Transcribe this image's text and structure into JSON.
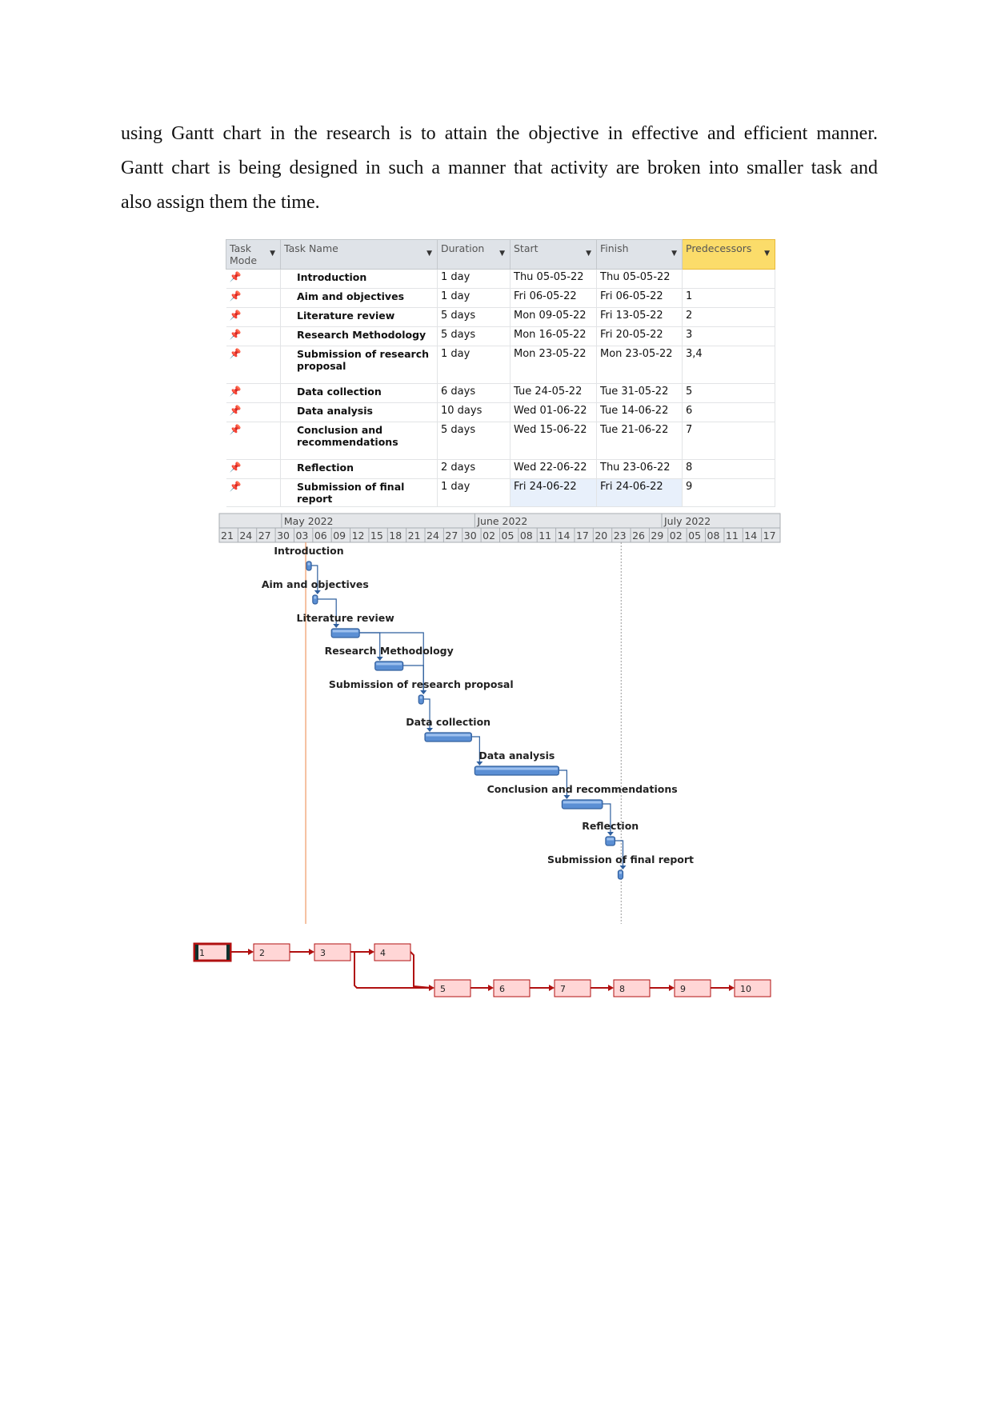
{
  "paragraph": {
    "lines": [
      "using Gantt chart in the research is to attain the objective in effective and efficient manner.",
      "Gantt chart is being designed in such a manner that activity are broken into smaller task and",
      "also assign them the time."
    ]
  },
  "table": {
    "headers": [
      "Task Mode",
      "Task Name",
      "Duration",
      "Start",
      "Finish",
      "Predecessors"
    ],
    "mode_icon": "pushpin-icon",
    "rows": [
      {
        "id": 1,
        "name": "Introduction",
        "duration": "1 day",
        "start": "Thu 05-05-22",
        "finish": "Thu 05-05-22",
        "pred": ""
      },
      {
        "id": 2,
        "name": "Aim and objectives",
        "duration": "1 day",
        "start": "Fri 06-05-22",
        "finish": "Fri 06-05-22",
        "pred": "1"
      },
      {
        "id": 3,
        "name": "Literature review",
        "duration": "5 days",
        "start": "Mon 09-05-22",
        "finish": "Fri 13-05-22",
        "pred": "2"
      },
      {
        "id": 4,
        "name": "Research Methodology",
        "duration": "5 days",
        "start": "Mon 16-05-22",
        "finish": "Fri 20-05-22",
        "pred": "3"
      },
      {
        "id": 5,
        "name": "Submission of research proposal",
        "duration": "1 day",
        "start": "Mon 23-05-22",
        "finish": "Mon 23-05-22",
        "pred": "3,4"
      },
      {
        "id": 6,
        "name": "Data collection",
        "duration": "6 days",
        "start": "Tue 24-05-22",
        "finish": "Tue 31-05-22",
        "pred": "5"
      },
      {
        "id": 7,
        "name": "Data analysis",
        "duration": "10 days",
        "start": "Wed 01-06-22",
        "finish": "Tue 14-06-22",
        "pred": "6"
      },
      {
        "id": 8,
        "name": "Conclusion and recommendations",
        "duration": "5 days",
        "start": "Wed 15-06-22",
        "finish": "Tue 21-06-22",
        "pred": "7"
      },
      {
        "id": 9,
        "name": "Reflection",
        "duration": "2 days",
        "start": "Wed 22-06-22",
        "finish": "Thu 23-06-22",
        "pred": "8"
      },
      {
        "id": 10,
        "name": "Submission of final report",
        "duration": "1 day",
        "start": "Fri 24-06-22",
        "finish": "Fri 24-06-22",
        "pred": "9"
      }
    ]
  },
  "gantt": {
    "months": [
      "May 2022",
      "June 2022",
      "July 2022"
    ],
    "ticks": [
      "21",
      "24",
      "27",
      "30",
      "03",
      "06",
      "09",
      "12",
      "15",
      "18",
      "21",
      "24",
      "27",
      "30",
      "02",
      "05",
      "08",
      "11",
      "14",
      "17",
      "20",
      "23",
      "26",
      "29",
      "02",
      "05",
      "08",
      "11",
      "14",
      "17"
    ],
    "bar_color": "#5b8fd4",
    "today_line_color": "#f0a070"
  },
  "network": {
    "nodes": [
      "1",
      "2",
      "3",
      "4",
      "5",
      "6",
      "7",
      "8",
      "9",
      "10"
    ],
    "node_fill": "#ffd6d6",
    "edge_color": "#b01010"
  }
}
